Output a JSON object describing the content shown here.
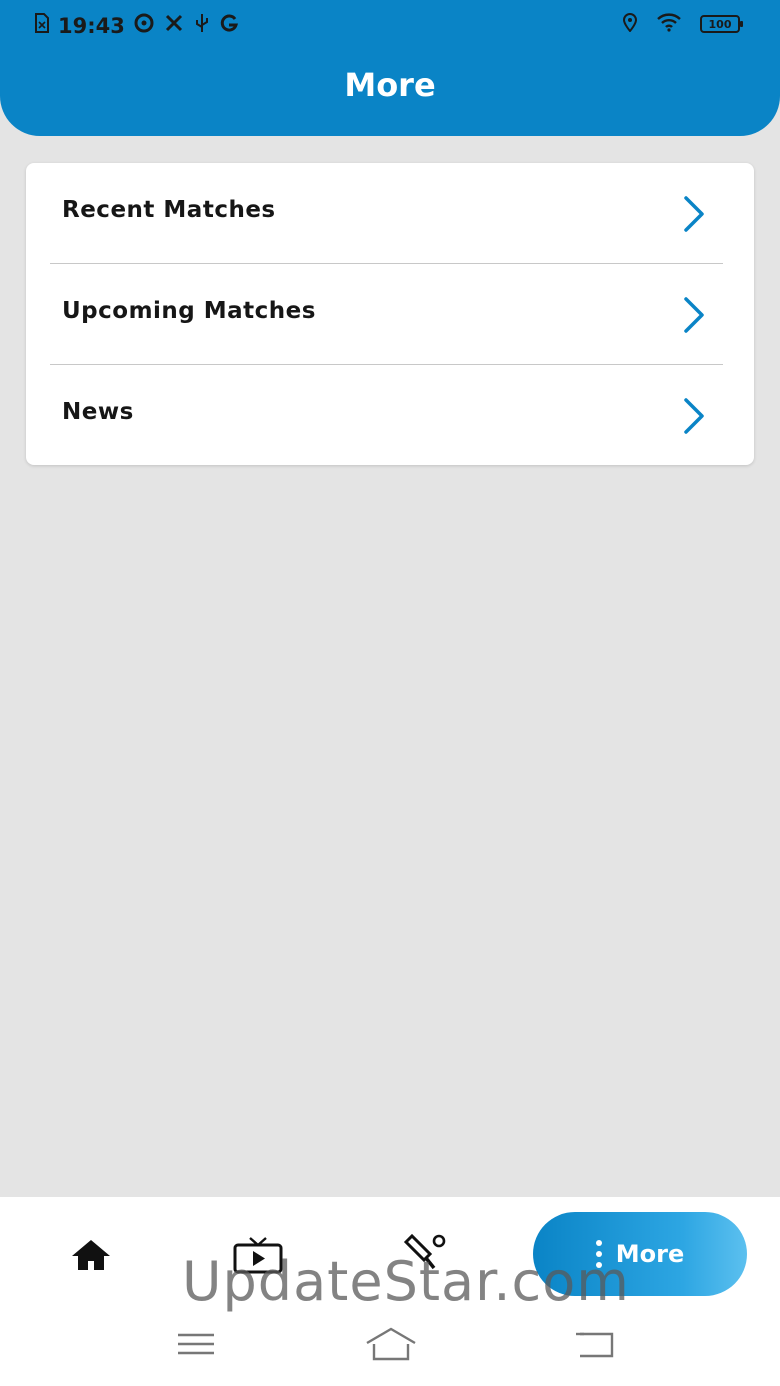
{
  "status_bar": {
    "time": "19:43",
    "battery": "100",
    "left_icons": [
      "sim-icon",
      "data-saver-icon",
      "tools-icon",
      "usb-icon",
      "google-icon"
    ],
    "right_icons": [
      "location-icon",
      "wifi-icon",
      "battery-icon"
    ]
  },
  "header": {
    "title": "More"
  },
  "menu": {
    "items": [
      {
        "label": "Recent Matches",
        "icon": "chevron-right-icon"
      },
      {
        "label": "Upcoming Matches",
        "icon": "chevron-right-icon"
      },
      {
        "label": "News",
        "icon": "chevron-right-icon"
      }
    ]
  },
  "bottom_nav": {
    "items": [
      {
        "name": "home",
        "icon": "home-icon"
      },
      {
        "name": "live-tv",
        "icon": "tv-play-icon"
      },
      {
        "name": "cricket",
        "icon": "cricket-bat-icon"
      }
    ],
    "active": {
      "label": "More",
      "icon": "vertical-dots-icon"
    }
  },
  "watermark": "UpdateStar.com",
  "system_nav": [
    "menu-icon",
    "home-outline-icon",
    "back-icon"
  ],
  "colors": {
    "primary": "#0a84c6",
    "background": "#e4e4e4",
    "card": "#ffffff",
    "text": "#161616"
  }
}
